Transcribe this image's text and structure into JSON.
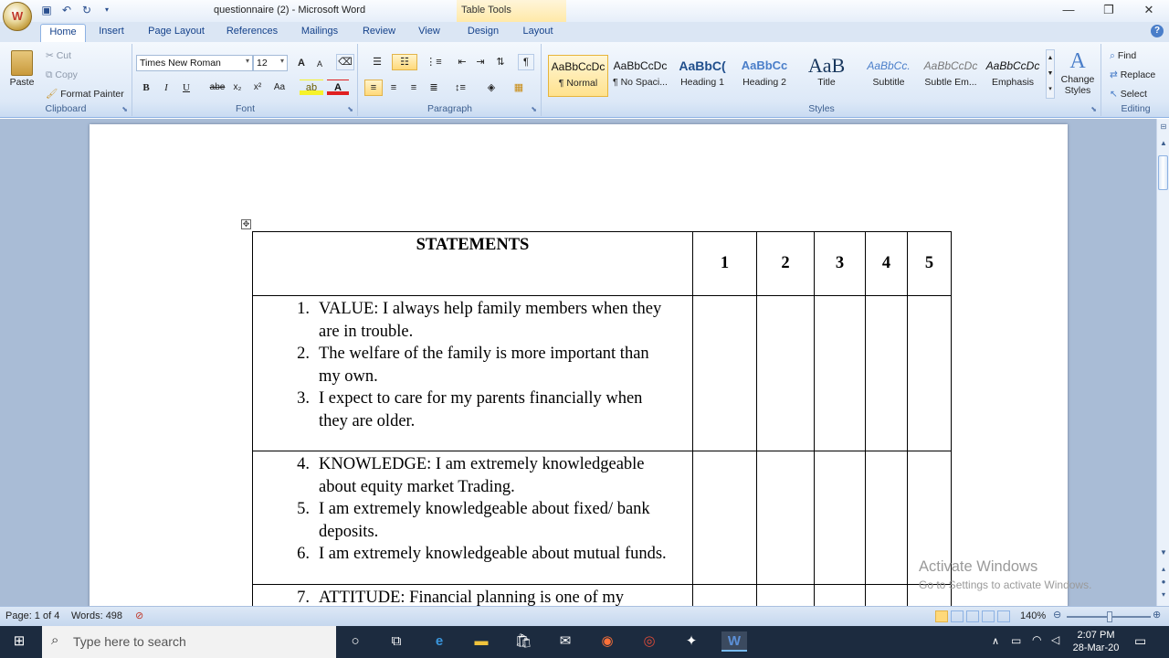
{
  "titlebar": {
    "doc_title": "questionnaire (2) - Microsoft Word",
    "context_tab": "Table Tools",
    "minimize": "—",
    "restore": "❐",
    "close": "✕",
    "office_button": "W"
  },
  "tabs": [
    {
      "label": "Home",
      "active": true
    },
    {
      "label": "Insert"
    },
    {
      "label": "Page Layout"
    },
    {
      "label": "References"
    },
    {
      "label": "Mailings"
    },
    {
      "label": "Review"
    },
    {
      "label": "View"
    },
    {
      "label": "Design"
    },
    {
      "label": "Layout"
    }
  ],
  "ribbon": {
    "clipboard": {
      "label": "Clipboard",
      "paste": "Paste",
      "cut": "Cut",
      "copy": "Copy",
      "format_painter": "Format Painter"
    },
    "font": {
      "label": "Font",
      "font_name": "Times New Roman",
      "font_size": "12",
      "bold": "B",
      "italic": "I",
      "underline": "U",
      "strike": "abe",
      "subscript": "x₂",
      "superscript": "x²",
      "change_case": "Aa",
      "grow": "A",
      "shrink": "A"
    },
    "paragraph": {
      "label": "Paragraph",
      "pilcrow": "¶"
    },
    "styles": {
      "label": "Styles",
      "items": [
        {
          "preview": "AaBbCcDc",
          "name": "¶ Normal",
          "selected": true
        },
        {
          "preview": "AaBbCcDc",
          "name": "¶ No Spaci..."
        },
        {
          "preview": "AaBbC(",
          "name": "Heading 1"
        },
        {
          "preview": "AaBbCc",
          "name": "Heading 2"
        },
        {
          "preview": "AaB",
          "name": "Title"
        },
        {
          "preview": "AaBbCc.",
          "name": "Subtitle"
        },
        {
          "preview": "AaBbCcDc",
          "name": "Subtle Em..."
        },
        {
          "preview": "AaBbCcDc",
          "name": "Emphasis"
        }
      ],
      "change_styles": "Change Styles"
    },
    "editing": {
      "label": "Editing",
      "find": "Find",
      "replace": "Replace",
      "select": "Select"
    }
  },
  "table": {
    "header": {
      "statements": "STATEMENTS",
      "scale": [
        "1",
        "2",
        "3",
        "4",
        "5"
      ]
    },
    "rows": [
      {
        "items": [
          {
            "n": "1.",
            "text": "VALUE: I always help family members when they are in trouble."
          },
          {
            "n": "2.",
            "text": "The welfare of the family is more important than my own."
          },
          {
            "n": "3.",
            "text": "I expect to care for my parents financially when they are older."
          }
        ]
      },
      {
        "items": [
          {
            "n": "4.",
            "text": "KNOWLEDGE: I am extremely knowledgeable about equity market Trading."
          },
          {
            "n": "5.",
            "text": "I am extremely knowledgeable about fixed/ bank deposits."
          },
          {
            "n": "6.",
            "text": "I am extremely knowledgeable about mutual funds."
          }
        ]
      },
      {
        "items": [
          {
            "n": "7.",
            "text": "ATTITUDE: Financial planning is one of my"
          }
        ]
      }
    ]
  },
  "watermark": {
    "line1": "Activate Windows",
    "line2": "Go to Settings to activate Windows."
  },
  "statusbar": {
    "page": "Page: 1 of 4",
    "words": "Words: 498",
    "zoom": "140%"
  },
  "taskbar": {
    "search_placeholder": "Type here to search",
    "time": "2:07 PM",
    "date": "28-Mar-20"
  }
}
